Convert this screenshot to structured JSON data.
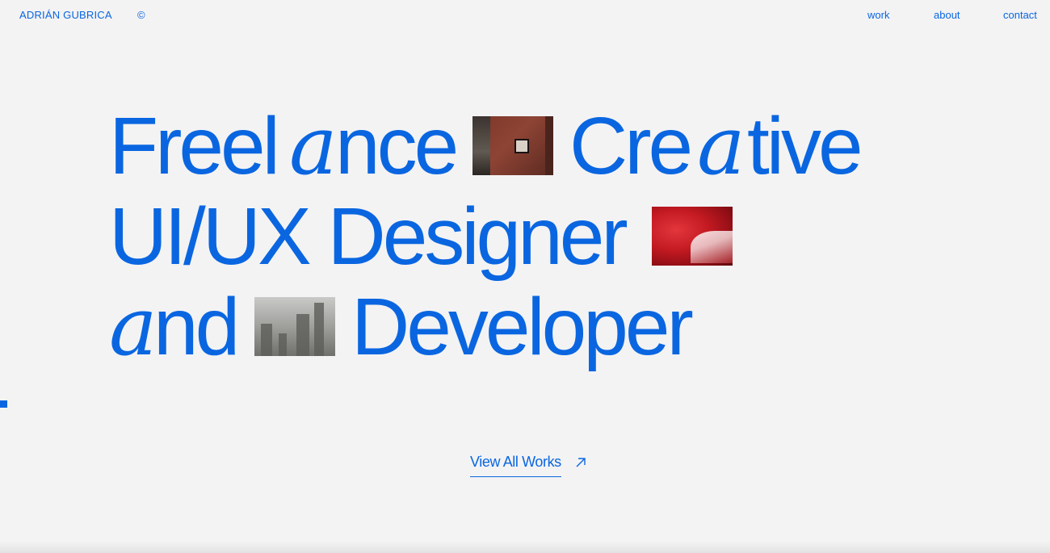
{
  "header": {
    "brand": "ADRIÁN GUBRICA",
    "copyright": "©",
    "nav": [
      "work",
      "about",
      "contact"
    ]
  },
  "hero": {
    "line1": {
      "a": "Freel",
      "b": "a",
      "c": "nce",
      "d": "Cre",
      "e": "a",
      "f": "tive"
    },
    "line2": {
      "a": "UI/UX Designer"
    },
    "line3": {
      "a": "a",
      "b": "nd",
      "c": "Developer"
    }
  },
  "cta": {
    "label": "View All Works",
    "icon": "arrow-up-right-icon"
  },
  "colors": {
    "accent": "#0a66e0",
    "background": "#f3f3f4"
  }
}
